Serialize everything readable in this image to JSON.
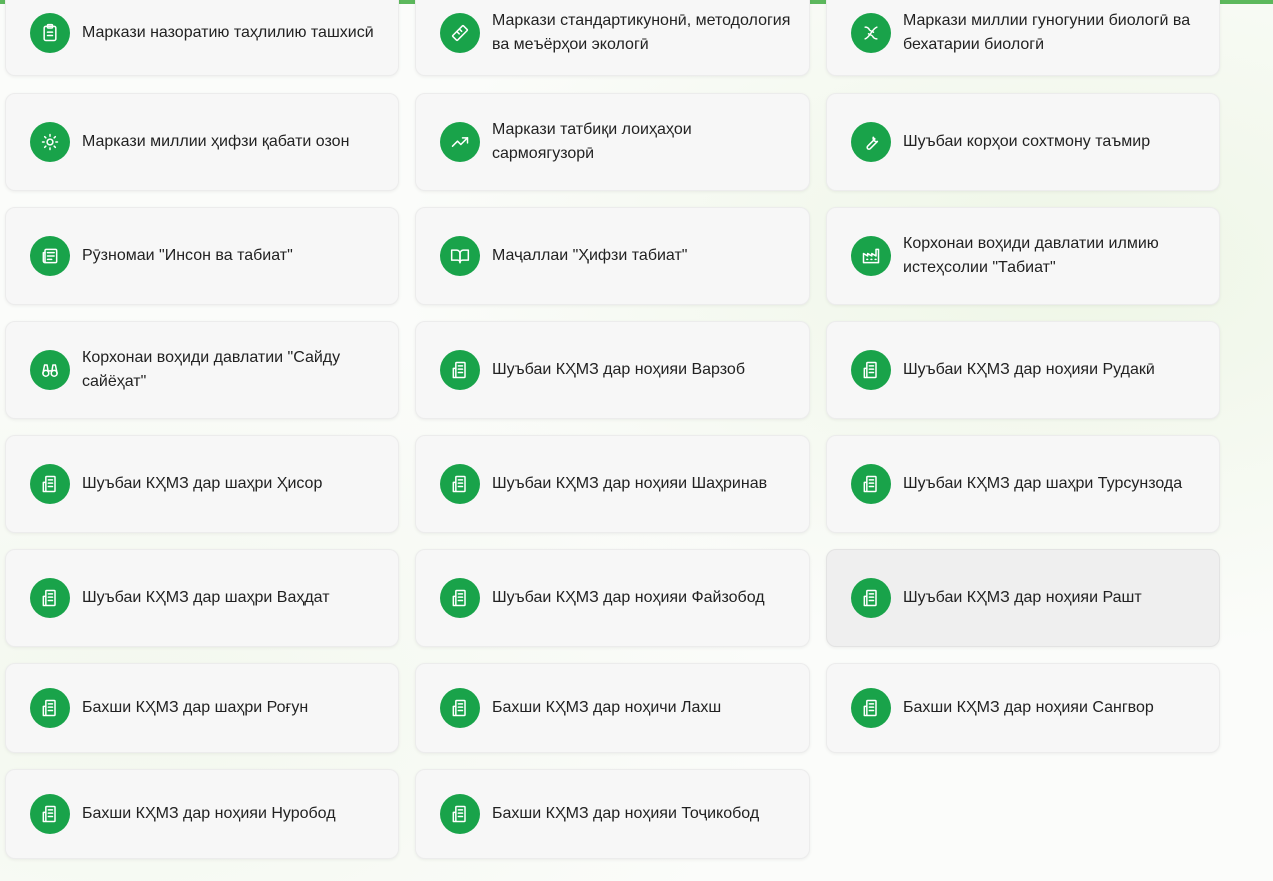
{
  "accent": "#19a34a",
  "cards": [
    {
      "label": "Маркази назоратию таҳлилию ташхисӣ",
      "icon": "clipboard-list-icon"
    },
    {
      "label": "Маркази стандартикунонӣ, методология ва меъёрҳои экологӣ",
      "icon": "ruler-icon"
    },
    {
      "label": "Маркази миллии гуногунии биологӣ ва бехатарии биологӣ",
      "icon": "dna-icon"
    },
    {
      "label": "Маркази миллии ҳифзи қабати озон",
      "icon": "sun-icon"
    },
    {
      "label": "Маркази татбиқи лоиҳаҳои сармоягузорӣ",
      "icon": "trending-up-icon"
    },
    {
      "label": "Шуъбаи корҳои сохтмону таъмир",
      "icon": "wrench-icon"
    },
    {
      "label": "Рӯзномаи \"Инсон ва табиат\"",
      "icon": "newspaper-icon"
    },
    {
      "label": "Маҷаллаи \"Ҳифзи табиат\"",
      "icon": "book-open-icon"
    },
    {
      "label": "Корхонаи воҳиди давлатии илмию истеҳсолии \"Табиат\"",
      "icon": "factory-icon"
    },
    {
      "label": "Корхонаи воҳиди давлатии \"Сайду сайёҳат\"",
      "icon": "binoculars-icon"
    },
    {
      "label": "Шуъбаи КҲМЗ дар ноҳияи Варзоб",
      "icon": "building-icon"
    },
    {
      "label": "Шуъбаи КҲМЗ дар ноҳияи Рудакӣ",
      "icon": "building-icon"
    },
    {
      "label": "Шуъбаи КҲМЗ дар шаҳри Ҳисор",
      "icon": "building-icon"
    },
    {
      "label": "Шуъбаи КҲМЗ дар ноҳияи Шаҳринав",
      "icon": "building-icon"
    },
    {
      "label": "Шуъбаи КҲМЗ дар шаҳри Турсунзода",
      "icon": "building-icon"
    },
    {
      "label": "Шуъбаи КҲМЗ дар шаҳри Ваҳдат",
      "icon": "building-icon"
    },
    {
      "label": "Шуъбаи КҲМЗ дар ноҳияи Файзобод",
      "icon": "building-icon"
    },
    {
      "label": "Шуъбаи КҲМЗ дар ноҳияи Рашт",
      "icon": "building-icon"
    },
    {
      "label": "Бахши КҲМЗ дар шаҳри Роғун",
      "icon": "building-icon"
    },
    {
      "label": "Бахши КҲМЗ дар ноҳичи Лахш",
      "icon": "building-icon"
    },
    {
      "label": "Бахши КҲМЗ дар ноҳияи Сангвор",
      "icon": "building-icon"
    },
    {
      "label": "Бахши КҲМЗ дар ноҳияи Нуробод",
      "icon": "building-icon"
    },
    {
      "label": "Бахши КҲМЗ дар ноҳияи Тоҷикобод",
      "icon": "building-icon"
    }
  ]
}
